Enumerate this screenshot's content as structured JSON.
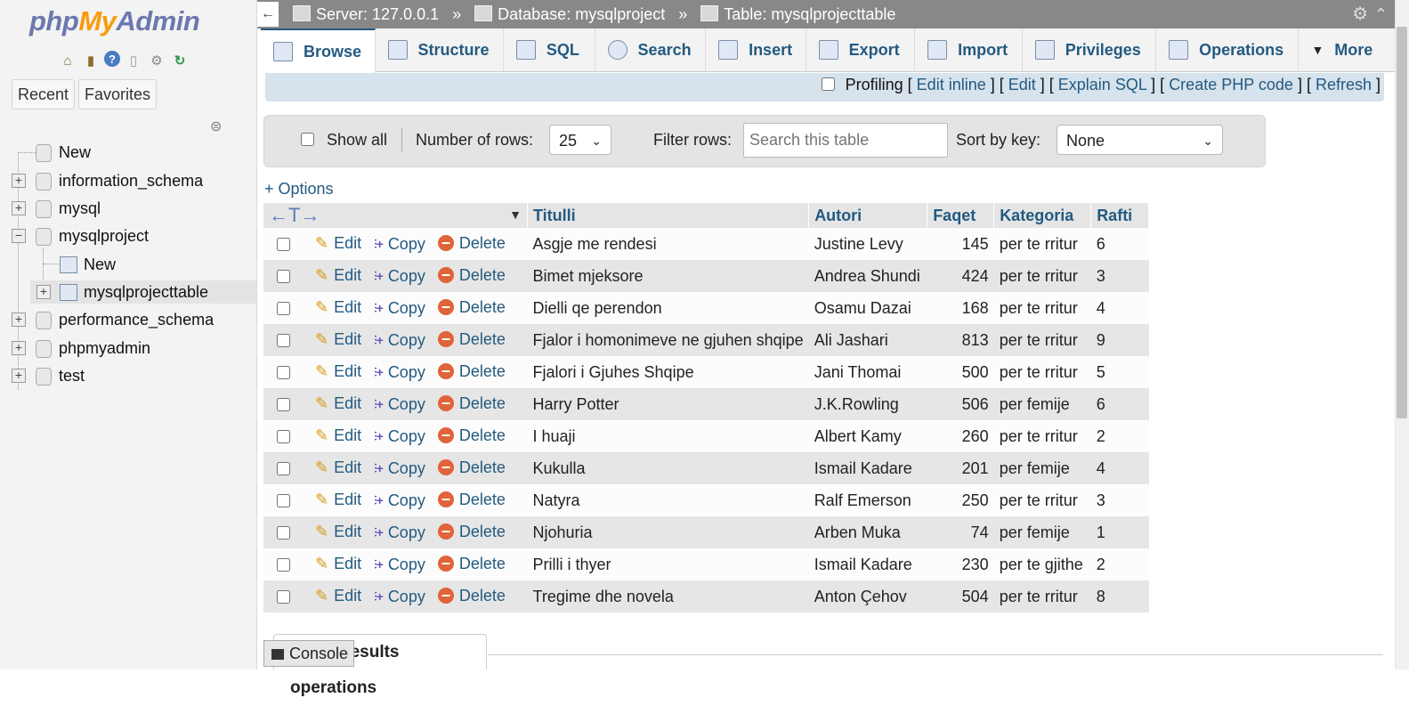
{
  "logo": {
    "php": "php",
    "my": "My",
    "admin": "Admin"
  },
  "nav": {
    "tab_recent": "Recent",
    "tab_favorites": "Favorites",
    "tree": [
      {
        "label": "New"
      },
      {
        "label": "information_schema"
      },
      {
        "label": "mysql"
      },
      {
        "label": "mysqlproject"
      },
      {
        "label": "New"
      },
      {
        "label": "mysqlprojecttable"
      },
      {
        "label": "performance_schema"
      },
      {
        "label": "phpmyadmin"
      },
      {
        "label": "test"
      }
    ]
  },
  "breadcrumb": {
    "back": "←",
    "server": "Server: 127.0.0.1",
    "sep": "»",
    "database": "Database: mysqlproject",
    "table": "Table: mysqlprojecttable"
  },
  "tabs": [
    {
      "label": "Browse"
    },
    {
      "label": "Structure"
    },
    {
      "label": "SQL"
    },
    {
      "label": "Search"
    },
    {
      "label": "Insert"
    },
    {
      "label": "Export"
    },
    {
      "label": "Import"
    },
    {
      "label": "Privileges"
    },
    {
      "label": "Operations"
    },
    {
      "label": "More"
    }
  ],
  "profiling": {
    "label": "Profiling",
    "edit_inline": "Edit inline",
    "edit": "Edit",
    "explain_sql": "Explain SQL",
    "create_php": "Create PHP code",
    "refresh": "Refresh"
  },
  "optbar": {
    "show_all": "Show all",
    "rows_label": "Number of rows:",
    "rows_value": "25",
    "filter_label": "Filter rows:",
    "filter_placeholder": "Search this table",
    "sort_label": "Sort by key:",
    "sort_value": "None"
  },
  "options_link": "+ Options",
  "table": {
    "arrows": "←T→",
    "columns": [
      "Titulli",
      "Autori",
      "Faqet",
      "Kategoria",
      "Rafti"
    ],
    "actions": {
      "edit": "Edit",
      "copy": "Copy",
      "delete": "Delete"
    },
    "rows": [
      [
        "Asgje me rendesi",
        "Justine Levy",
        "145",
        "per te rritur",
        "6"
      ],
      [
        "Bimet mjeksore",
        "Andrea Shundi",
        "424",
        "per te rritur",
        "3"
      ],
      [
        "Dielli qe perendon",
        "Osamu Dazai",
        "168",
        "per te rritur",
        "4"
      ],
      [
        "Fjalor i homonimeve ne gjuhen shqipe",
        "Ali Jashari",
        "813",
        "per te rritur",
        "9"
      ],
      [
        "Fjalori i Gjuhes Shqipe",
        "Jani Thomai",
        "500",
        "per te rritur",
        "5"
      ],
      [
        "Harry Potter",
        "J.K.Rowling",
        "506",
        "per femije",
        "6"
      ],
      [
        "I huaji",
        "Albert Kamy",
        "260",
        "per te rritur",
        "2"
      ],
      [
        "Kukulla",
        "Ismail Kadare",
        "201",
        "per femije",
        "4"
      ],
      [
        "Natyra",
        "Ralf Emerson",
        "250",
        "per te rritur",
        "3"
      ],
      [
        "Njohuria",
        "Arben Muka",
        "74",
        "per femije",
        "1"
      ],
      [
        "Prilli i thyer",
        "Ismail Kadare",
        "230",
        "per te gjithe",
        "2"
      ],
      [
        "Tregime dhe novela",
        "Anton Çehov",
        "504",
        "per te rritur",
        "8"
      ]
    ]
  },
  "bottom": {
    "query_results_ops": "Query results operations",
    "console": "Console"
  },
  "colors": {
    "link": "#235a81",
    "topbar": "#888888",
    "accent_orange": "#f89c0e"
  }
}
